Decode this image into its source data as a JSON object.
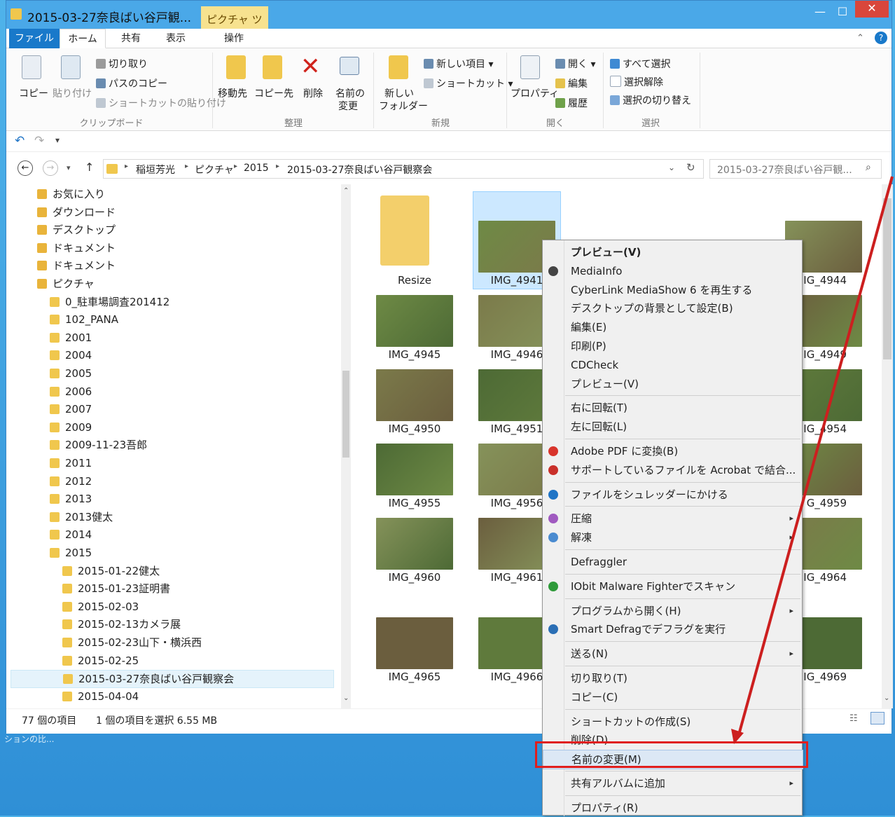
{
  "window": {
    "title": "2015-03-27奈良ばい谷戸観...",
    "context_tab": "ピクチャ ツール",
    "controls": {
      "minimize": "—",
      "maximize": "☐",
      "close": "✕"
    }
  },
  "ribbon_tabs": [
    "ファイル",
    "ホーム",
    "共有",
    "表示",
    "操作"
  ],
  "ribbon": {
    "clipboard": {
      "copy": "コピー",
      "paste": "貼り付け",
      "cut": "切り取り",
      "copy_path": "パスのコピー",
      "paste_shortcut": "ショートカットの貼り付け",
      "label": "クリップボード"
    },
    "organize": {
      "move_to": "移動先",
      "copy_to": "コピー先",
      "delete": "削除",
      "rename_1": "名前の",
      "rename_2": "変更",
      "label": "整理"
    },
    "new": {
      "new_folder_1": "新しい",
      "new_folder_2": "フォルダー",
      "new_item": "新しい項目",
      "shortcut": "ショートカット",
      "label": "新規"
    },
    "open": {
      "properties": "プロパティ",
      "open": "開く",
      "edit": "編集",
      "history": "履歴",
      "label": "開く"
    },
    "select": {
      "select_all": "すべて選択",
      "select_none": "選択解除",
      "invert": "選択の切り替え",
      "label": "選択"
    }
  },
  "address": {
    "breadcrumb": [
      "稲垣芳光",
      "ピクチャ",
      "2015",
      "2015-03-27奈良ばい谷戸観察会"
    ],
    "search_placeholder": "2015-03-27奈良ばい谷戸観..."
  },
  "nav_tree": [
    {
      "label": "お気に入り",
      "level": 0
    },
    {
      "label": "ダウンロード",
      "level": 0
    },
    {
      "label": "デスクトップ",
      "level": 0
    },
    {
      "label": "ドキュメント",
      "level": 0
    },
    {
      "label": "ドキュメント",
      "level": 0
    },
    {
      "label": "ピクチャ",
      "level": 0
    },
    {
      "label": "0_駐車場調査201412",
      "level": 1
    },
    {
      "label": "102_PANA",
      "level": 1
    },
    {
      "label": "2001",
      "level": 1
    },
    {
      "label": "2004",
      "level": 1
    },
    {
      "label": "2005",
      "level": 1
    },
    {
      "label": "2006",
      "level": 1
    },
    {
      "label": "2007",
      "level": 1
    },
    {
      "label": "2009",
      "level": 1
    },
    {
      "label": "2009-11-23吾郎",
      "level": 1
    },
    {
      "label": "2011",
      "level": 1
    },
    {
      "label": "2012",
      "level": 1
    },
    {
      "label": "2013",
      "level": 1
    },
    {
      "label": "2013健太",
      "level": 1
    },
    {
      "label": "2014",
      "level": 1
    },
    {
      "label": "2015",
      "level": 1
    },
    {
      "label": "2015-01-22健太",
      "level": 2
    },
    {
      "label": "2015-01-23証明書",
      "level": 2
    },
    {
      "label": "2015-02-03",
      "level": 2
    },
    {
      "label": "2015-02-13カメラ展",
      "level": 2
    },
    {
      "label": "2015-02-23山下・横浜西",
      "level": 2
    },
    {
      "label": "2015-02-25",
      "level": 2
    },
    {
      "label": "2015-03-27奈良ばい谷戸観察会",
      "level": 2,
      "selected": true
    },
    {
      "label": "2015-04-04",
      "level": 2
    }
  ],
  "files": [
    [
      "Resize",
      "IMG_4941",
      "",
      "",
      "IG_4944"
    ],
    [
      "IMG_4945",
      "IMG_4946",
      "",
      "",
      "IG_4949"
    ],
    [
      "IMG_4950",
      "IMG_4951",
      "",
      "",
      "IG_4954"
    ],
    [
      "IMG_4955",
      "IMG_4956",
      "",
      "",
      "G_4959"
    ],
    [
      "IMG_4960",
      "IMG_4961",
      "",
      "",
      "IG_4964"
    ],
    [
      "IMG_4965",
      "IMG_4966",
      "",
      "",
      "IG_4969"
    ]
  ],
  "status": {
    "count": "77 個の項目",
    "selection": "1 個の項目を選択 6.55 MB"
  },
  "desktop_text": "ションの比...",
  "context_menu": [
    {
      "label": "プレビュー(V)",
      "bold": true
    },
    {
      "label": "MediaInfo",
      "icon": "sound-icon"
    },
    {
      "label": "CyberLink MediaShow 6 を再生する"
    },
    {
      "label": "デスクトップの背景として設定(B)"
    },
    {
      "label": "編集(E)"
    },
    {
      "label": "印刷(P)"
    },
    {
      "label": "CDCheck"
    },
    {
      "label": "プレビュー(V)"
    },
    {
      "sep": true
    },
    {
      "label": "右に回転(T)"
    },
    {
      "label": "左に回転(L)"
    },
    {
      "sep": true
    },
    {
      "label": "Adobe PDF に変換(B)",
      "icon": "pdf-icon"
    },
    {
      "label": "サポートしているファイルを Acrobat で結合...",
      "icon": "acrobat-icon"
    },
    {
      "sep": true
    },
    {
      "label": "ファイルをシュレッダーにかける",
      "icon": "shredder-icon"
    },
    {
      "sep": true
    },
    {
      "label": "圧縮",
      "icon": "compress-icon",
      "submenu": true
    },
    {
      "label": "解凍",
      "icon": "extract-icon",
      "submenu": true
    },
    {
      "sep": true
    },
    {
      "label": "Defraggler"
    },
    {
      "sep": true
    },
    {
      "label": "IObit Malware Fighterでスキャン",
      "icon": "shield-icon"
    },
    {
      "sep": true
    },
    {
      "label": "プログラムから開く(H)",
      "submenu": true
    },
    {
      "label": "Smart Defragでデフラグを実行",
      "icon": "defrag-icon"
    },
    {
      "sep": true
    },
    {
      "label": "送る(N)",
      "submenu": true
    },
    {
      "sep": true
    },
    {
      "label": "切り取り(T)"
    },
    {
      "label": "コピー(C)"
    },
    {
      "sep": true
    },
    {
      "label": "ショートカットの作成(S)"
    },
    {
      "label": "削除(D)"
    },
    {
      "label": "名前の変更(M)",
      "highlighted": true
    },
    {
      "sep": true
    },
    {
      "label": "共有アルバムに追加",
      "submenu": true
    },
    {
      "sep": true
    },
    {
      "label": "プロパティ(R)"
    }
  ],
  "colors": {
    "accent": "#1979ca",
    "highlight_box": "#e01e1e",
    "arrow": "#cc1f1f",
    "selection": "#cce8ff"
  }
}
